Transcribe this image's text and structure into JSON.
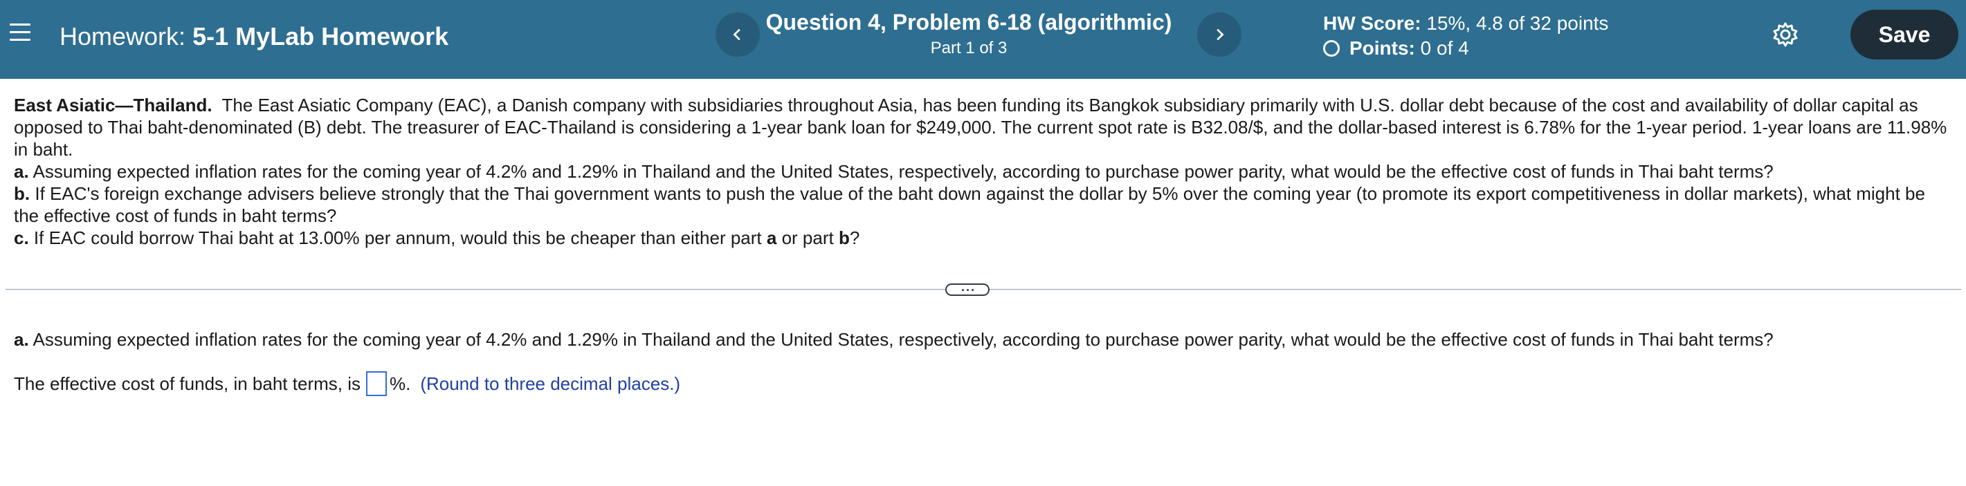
{
  "header": {
    "homework_prefix": "Homework:",
    "homework_name": "5-1 MyLab Homework",
    "question_title": "Question 4, Problem 6-18 (algorithmic)",
    "part_label": "Part 1 of 3",
    "hw_score_label": "HW Score:",
    "hw_score_value": "15%, 4.8 of 32 points",
    "points_label": "Points:",
    "points_value": "0 of 4",
    "save_label": "Save"
  },
  "question": {
    "intro_title": "East Asiatic—Thailand.",
    "intro_text": "The East Asiatic Company (EAC), a Danish company with subsidiaries throughout Asia, has been funding its Bangkok subsidiary primarily with U.S. dollar debt because of the cost and availability of dollar capital as opposed to Thai baht-denominated (B) debt. The treasurer of EAC-Thailand is considering a 1-year bank loan for $249,000. The current spot rate is B32.08/$, and the dollar-based interest is 6.78% for the 1-year period. 1-year loans are 11.98% in baht.",
    "a_label": "a.",
    "a_text": "Assuming expected inflation rates for the coming year of 4.2% and 1.29% in Thailand and the United States, respectively, according to purchase power parity, what would be the effective cost of funds in Thai baht terms?",
    "b_label": "b.",
    "b_text": "If EAC's foreign exchange advisers believe strongly that the Thai government wants to push the value of the baht down against the dollar by 5% over the coming year (to promote its export competitiveness in dollar markets), what might be the effective cost of funds in baht terms?",
    "c_label": "c.",
    "c_text_1": "If EAC could borrow Thai baht at 13.00% per annum, would this be cheaper than either part",
    "c_a": "a",
    "c_or": "or part",
    "c_b": "b",
    "c_end": "?"
  },
  "part": {
    "label": "a.",
    "text": "Assuming expected inflation rates for the coming year of 4.2% and 1.29% in Thailand and the United States, respectively, according to purchase power parity, what would be the effective cost of funds in Thai baht terms?",
    "answer_prefix": "The effective cost of funds, in baht terms, is",
    "answer_value": "",
    "answer_suffix": "%.",
    "hint": "(Round to three decimal places.)"
  }
}
